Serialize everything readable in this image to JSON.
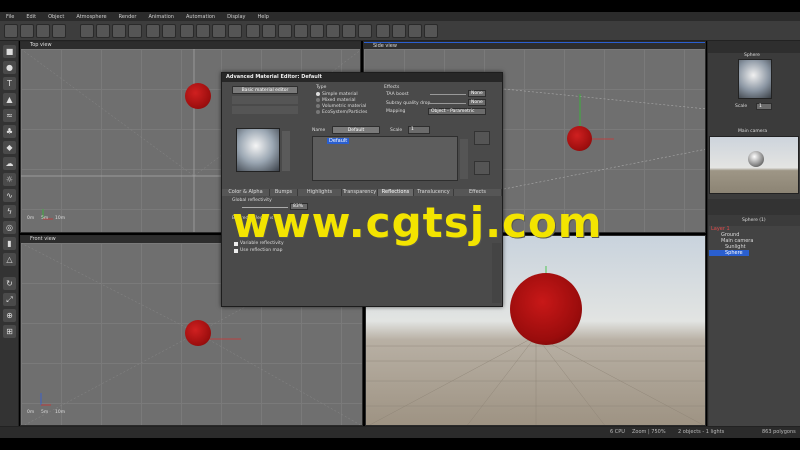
{
  "menu": [
    "File",
    "Edit",
    "Object",
    "Atmosphere",
    "Render",
    "Animation",
    "Automation",
    "Display",
    "Help"
  ],
  "viewports": {
    "top": {
      "title": "Top view"
    },
    "side": {
      "title": "Side view"
    },
    "front": {
      "title": "Front view"
    },
    "axis_labels": [
      "0m",
      "5m",
      "10m"
    ]
  },
  "dialog": {
    "title": "Advanced Material Editor: Default",
    "basic_button": "Basic material editor",
    "type_label": "Type",
    "types": [
      "Simple material",
      "Mixed material",
      "Volumetric material",
      "EcoSystem/Particles"
    ],
    "effects_label": "Effects",
    "taa_label": "TAA boost",
    "taa_value": "None",
    "subray_label": "Subray quality drop",
    "subray_value": "None",
    "mapping_label": "Mapping",
    "mapping_value": "Object - Parametric",
    "name_label": "Name",
    "name_value": "Default",
    "scale_label": "Scale",
    "scale_value": "1",
    "layer_item": "Default",
    "tabs": [
      "Color & Alpha",
      "Bumps",
      "Highlights",
      "Transparency",
      "Reflections",
      "Translucency",
      "Effects"
    ],
    "active_tab": "Reflections",
    "global_reflectivity_label": "Global reflectivity",
    "global_reflectivity_value": "83%",
    "blurred_label": "Blurred reflections",
    "variable_reflectivity": "Variable reflectivity",
    "use_reflection_map": "Use reflection map"
  },
  "rightpanel": {
    "sphere_label": "Sphere",
    "scale_label": "Scale",
    "scale_value": "1",
    "camera_label": "Main camera",
    "sphere_count": "Sphere (1)",
    "scene_items": [
      "Layer 1",
      "Ground",
      "Main camera",
      "Sunlight",
      "Sphere"
    ]
  },
  "status": {
    "cpu": "6 CPU",
    "zoom": "Zoom | 750%",
    "objects": "2 objects - 1 lights",
    "polygons": "863 polygons"
  },
  "watermark": "www.cgtsj.com",
  "colors": {
    "sphere": "#b51515",
    "watermark": "#f3e400",
    "accent": "#2a5fd0"
  }
}
